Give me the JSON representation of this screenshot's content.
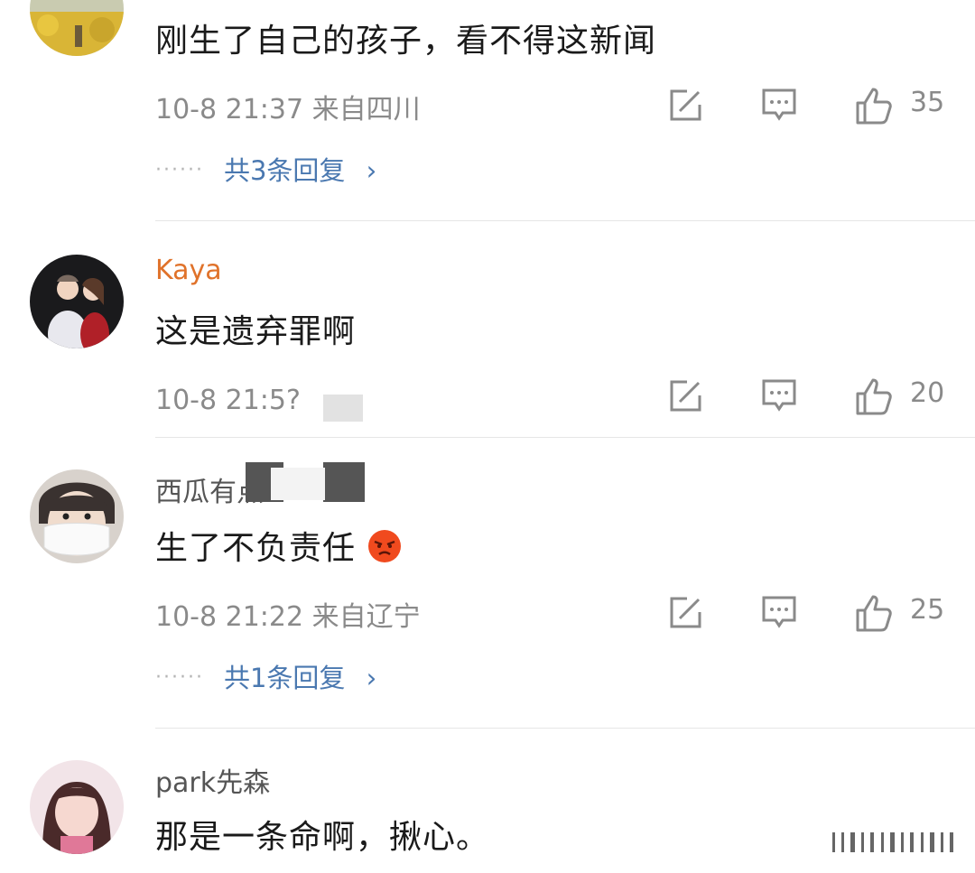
{
  "comments": [
    {
      "text": "刚生了自己的孩子，看不得这新闻",
      "meta": "10-8 21:37 来自四川",
      "likes": "35",
      "replies": "共3条回复",
      "replies_arrow": "›"
    },
    {
      "username": "Kaya",
      "text": "这是遗弃罪啊",
      "meta": "10-8 21:5? 来自广东",
      "likes": "20"
    },
    {
      "username": "西瓜有点",
      "text": "生了不负责任",
      "meta": "10-8 21:22 来自辽宁",
      "likes": "25",
      "replies": "共1条回复",
      "replies_arrow": "›"
    },
    {
      "username": "park先森",
      "text": "那是一条命啊，揪心。"
    }
  ],
  "ui": {
    "dots": "······",
    "accent_link": "#4a78b0",
    "accent_name": "#e0722a",
    "icons": [
      "repost-icon",
      "comment-icon",
      "like-icon"
    ]
  }
}
